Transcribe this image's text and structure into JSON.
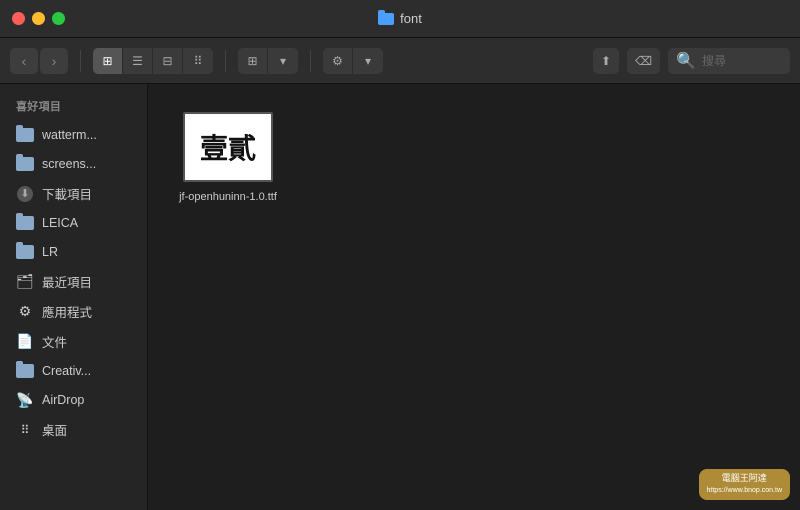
{
  "titlebar": {
    "title": "font",
    "folder_icon": "folder-icon"
  },
  "toolbar": {
    "back_label": "‹",
    "forward_label": "›",
    "view_icons": [
      "⊞",
      "☰",
      "⊟",
      "⠿"
    ],
    "view_group_label": "⊞",
    "gear_label": "⚙",
    "share_label": "⬆",
    "delete_label": "⌫",
    "search_placeholder": "搜尋"
  },
  "sidebar": {
    "section_label": "喜好項目",
    "items": [
      {
        "id": "waterm",
        "label": "watterm...",
        "icon": "folder"
      },
      {
        "id": "screens",
        "label": "screens...",
        "icon": "folder"
      },
      {
        "id": "downloads",
        "label": "下載項目",
        "icon": "download"
      },
      {
        "id": "leica",
        "label": "LEICA",
        "icon": "folder"
      },
      {
        "id": "lr",
        "label": "LR",
        "icon": "folder"
      },
      {
        "id": "recent",
        "label": "最近項目",
        "icon": "recent"
      },
      {
        "id": "apps",
        "label": "應用程式",
        "icon": "apps"
      },
      {
        "id": "docs",
        "label": "文件",
        "icon": "doc"
      },
      {
        "id": "creative",
        "label": "Creativ...",
        "icon": "folder"
      },
      {
        "id": "airdrop",
        "label": "AirDrop",
        "icon": "airdrop"
      },
      {
        "id": "desktop",
        "label": "桌面",
        "icon": "desktop"
      }
    ]
  },
  "file_area": {
    "files": [
      {
        "id": "jf-font",
        "preview_text": "壹貳",
        "name": "jf-openhuninn-1.0.ttf"
      }
    ]
  }
}
